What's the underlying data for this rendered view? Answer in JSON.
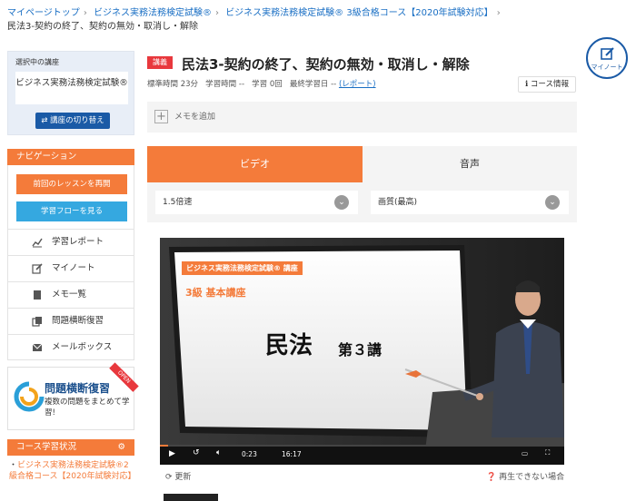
{
  "breadcrumb": {
    "items": [
      "マイページトップ",
      "ビジネス実務法務検定試験®",
      "ビジネス実務法務検定試験® 3級合格コース【2020年試験対応】"
    ],
    "current": "民法3-契約の終了、契約の無効・取消し・解除"
  },
  "sidebar": {
    "selected_label": "選択中の講座",
    "course_name": "ビジネス実務法務検定試験®",
    "switch_label": "講座の切り替え",
    "nav_title": "ナビゲーション",
    "resume_label": "前回のレッスンを再開",
    "flow_label": "学習フローを見る",
    "items": [
      {
        "label": "学習レポート",
        "icon": "chart-icon"
      },
      {
        "label": "マイノート",
        "icon": "pen-icon"
      },
      {
        "label": "メモ一覧",
        "icon": "memo-icon"
      },
      {
        "label": "問題横断復習",
        "icon": "review-icon"
      },
      {
        "label": "メールボックス",
        "icon": "mail-icon"
      }
    ],
    "banner": {
      "title": "問題横断復習",
      "desc": "複数の問題をまとめて学習!",
      "ribbon": "OPEN"
    },
    "course_status_title": "コース学習状況",
    "course_status_link": "ビジネス実務法務検定試験®2級合格コース【2020年試験対応】"
  },
  "main": {
    "badge": "講義",
    "title": "民法3-契約の終了、契約の無効・取消し・解除",
    "meta": {
      "std_time_label": "標準時間",
      "std_time": "23分",
      "study_time_label": "学習時間",
      "study_time": "--",
      "study_count_label": "学習",
      "study_count": "0回",
      "last_label": "最終学習日",
      "last": "--",
      "report_link": "(レポート)"
    },
    "course_info": "コース情報",
    "memo_add": "メモを追加",
    "tabs": [
      "ビデオ",
      "音声"
    ],
    "speed": "1.5倍速",
    "quality": "画質(最高)",
    "video": {
      "tag": "ビジネス実務法務検定試験® 講座",
      "level": "3級 基本講座",
      "main": "民法",
      "sub": "第３講",
      "time_current": "0:23",
      "time_total": "16:17"
    },
    "refresh": "更新",
    "cannot_play": "再生できない場合"
  },
  "mynote_label": "マイノート",
  "colors": {
    "accent": "#f47b3a",
    "link": "#1a6fc4",
    "primary": "#1a5aa6",
    "badge": "#e8383d"
  }
}
